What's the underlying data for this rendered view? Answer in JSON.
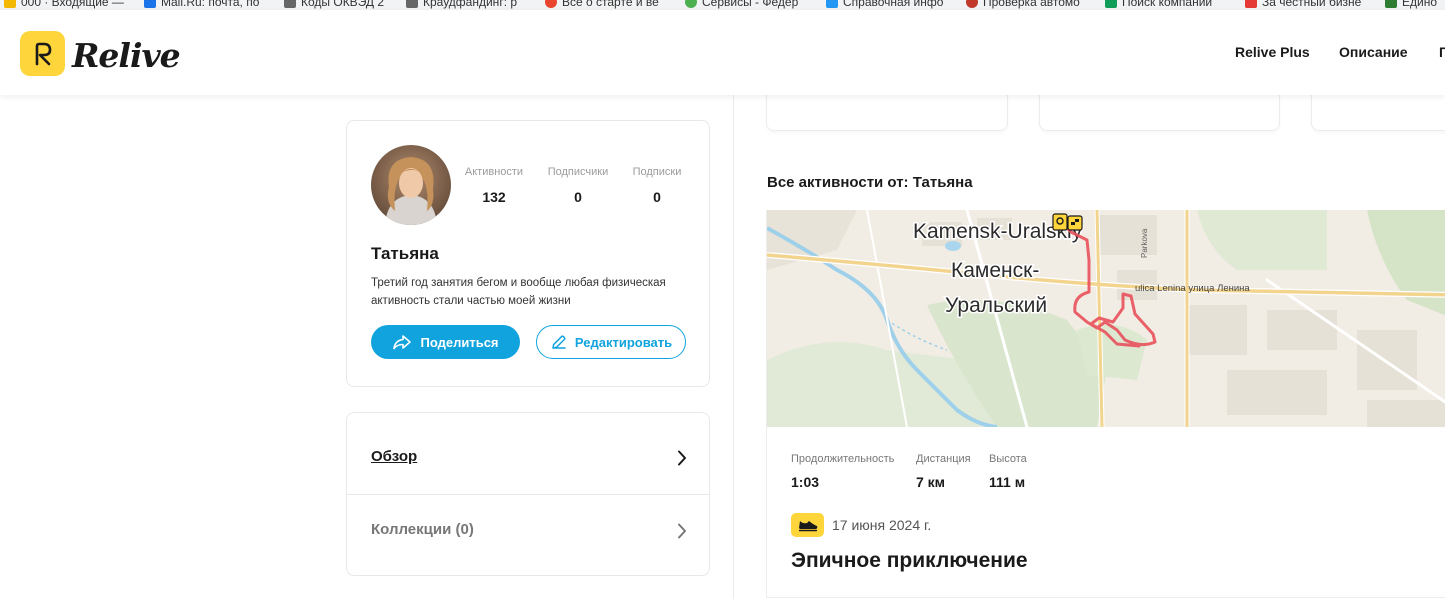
{
  "bookmarks": [
    {
      "label": "000 · Входящие —",
      "color": "#f5b800"
    },
    {
      "label": "Mail.Ru: почта, по",
      "color": "#1a73e8"
    },
    {
      "label": "Коды ОКВЭД 2",
      "color": "#555555"
    },
    {
      "label": "Краудфандинг: р",
      "color": "#555555"
    },
    {
      "label": "Все о старте и ве",
      "color": "#e8442e"
    },
    {
      "label": "Сервисы - Федер",
      "color": "#4caf50"
    },
    {
      "label": "Справочная инфо",
      "color": "#2196f3"
    },
    {
      "label": "Проверка автомо",
      "color": "#c0392b"
    },
    {
      "label": "Поиск компаний",
      "color": "#0f9d58"
    },
    {
      "label": "За честный бизне",
      "color": "#e53935"
    },
    {
      "label": "Едино",
      "color": "#2e7d32"
    }
  ],
  "header": {
    "logo_text": "Relive",
    "nav": [
      "Relive Plus",
      "Описание",
      "П"
    ]
  },
  "profile": {
    "name": "Татьяна",
    "bio": "Третий год занятия бегом и вообще любая физическая активность стали частью моей жизни",
    "stats": [
      {
        "label": "Активности",
        "value": "132"
      },
      {
        "label": "Подписчики",
        "value": "0"
      },
      {
        "label": "Подписки",
        "value": "0"
      }
    ],
    "share_label": "Поделиться",
    "edit_label": "Редактировать"
  },
  "menu": {
    "overview_label": "Обзор",
    "collections_label": "Коллекции (0)"
  },
  "activities": {
    "section_title": "Все активности от: Татьяна",
    "map_labels": {
      "city_latin": "Kamensk-Uralskiy",
      "city_ru_line1": "Каменск-",
      "city_ru_line2": "Уральский",
      "street": "ulica Lenina улица Ленина",
      "street_side": "Parkova"
    },
    "metrics": [
      {
        "label": "Продолжительность",
        "value": "1:03"
      },
      {
        "label": "Дистанция",
        "value": "7 км"
      },
      {
        "label": "Высота",
        "value": "111 м"
      }
    ],
    "date": "17 июня 2024 г.",
    "title": "Эпичное приключение"
  },
  "colors": {
    "brand_yellow": "#fed53b",
    "primary_blue": "#11a3dd",
    "route_red": "#e8505b"
  }
}
